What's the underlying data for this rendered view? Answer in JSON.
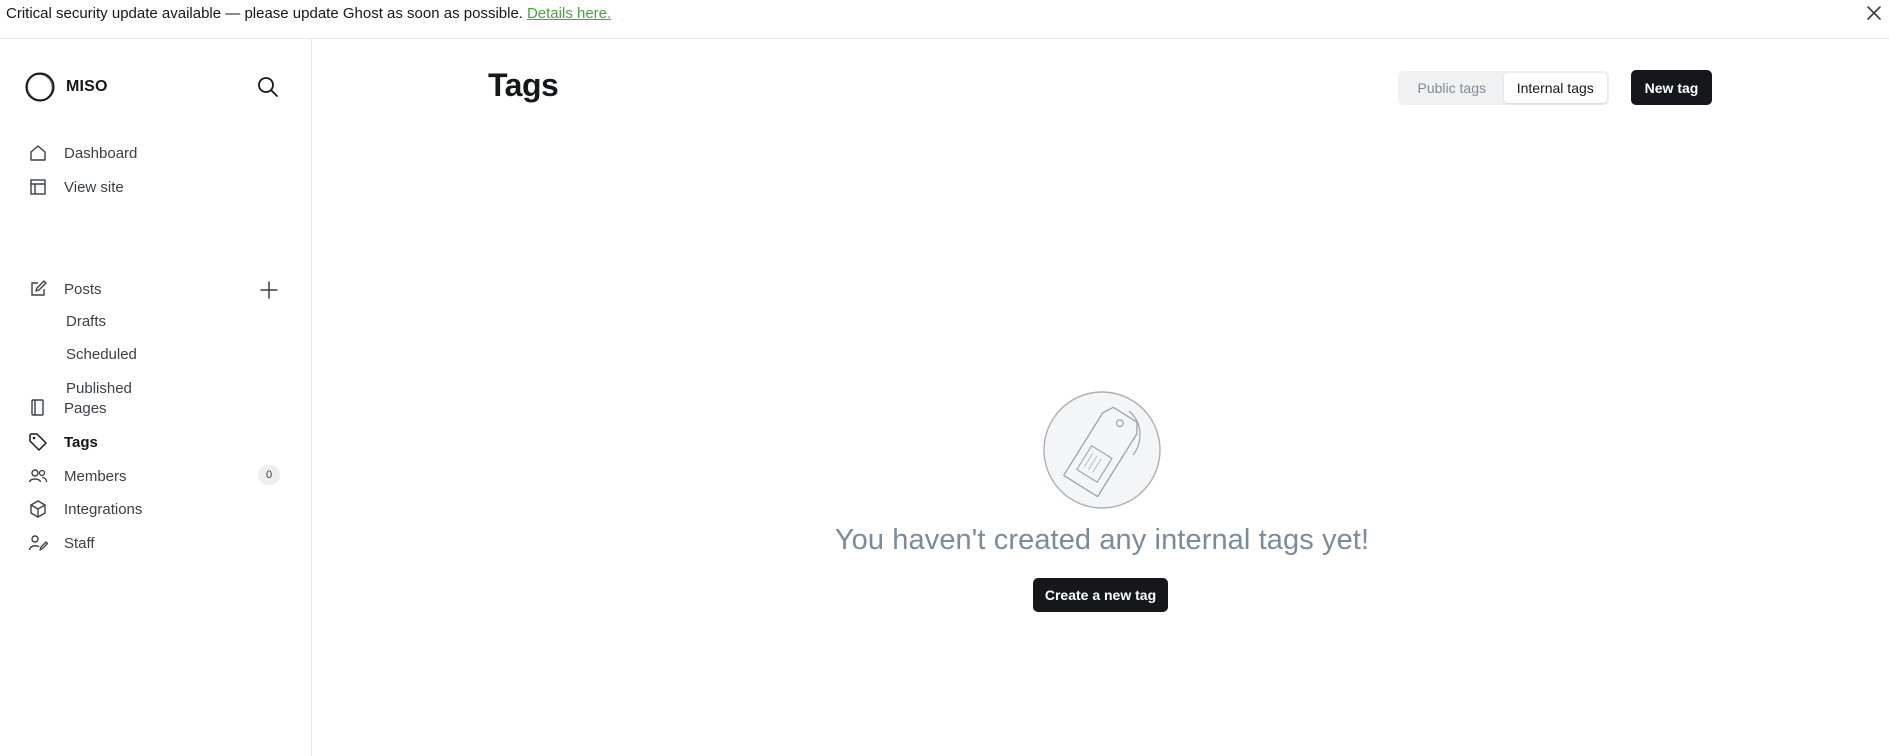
{
  "banner": {
    "message": "Critical security update available — please update Ghost as soon as possible.",
    "link_label": "Details here.",
    "close_icon": "close-icon"
  },
  "sidebar": {
    "site_name": "MISO",
    "search_icon": "search-icon",
    "items": [
      {
        "label": "Dashboard",
        "icon": "home-icon"
      },
      {
        "label": "View site",
        "icon": "layout-icon"
      },
      {
        "label": "Posts",
        "icon": "pencil-square-icon"
      },
      {
        "label": "Pages",
        "icon": "page-icon"
      },
      {
        "label": "Tags",
        "icon": "tag-icon"
      },
      {
        "label": "Members",
        "icon": "members-icon"
      },
      {
        "label": "Integrations",
        "icon": "cube-icon"
      },
      {
        "label": "Staff",
        "icon": "staff-icon"
      }
    ],
    "post_subitems": [
      {
        "label": "Drafts"
      },
      {
        "label": "Scheduled"
      },
      {
        "label": "Published"
      }
    ],
    "members_count": "0",
    "active_item": "Tags"
  },
  "main": {
    "title": "Tags",
    "tabs": [
      {
        "label": "Public tags",
        "selected": false
      },
      {
        "label": "Internal tags",
        "selected": true
      }
    ],
    "new_tag_label": "New tag",
    "empty_message": "You haven't created any internal tags yet!",
    "create_label": "Create a new tag"
  },
  "colors": {
    "accent_dark": "#15171a",
    "muted_text": "#7c8b9a",
    "link_green": "#4aa33f"
  }
}
